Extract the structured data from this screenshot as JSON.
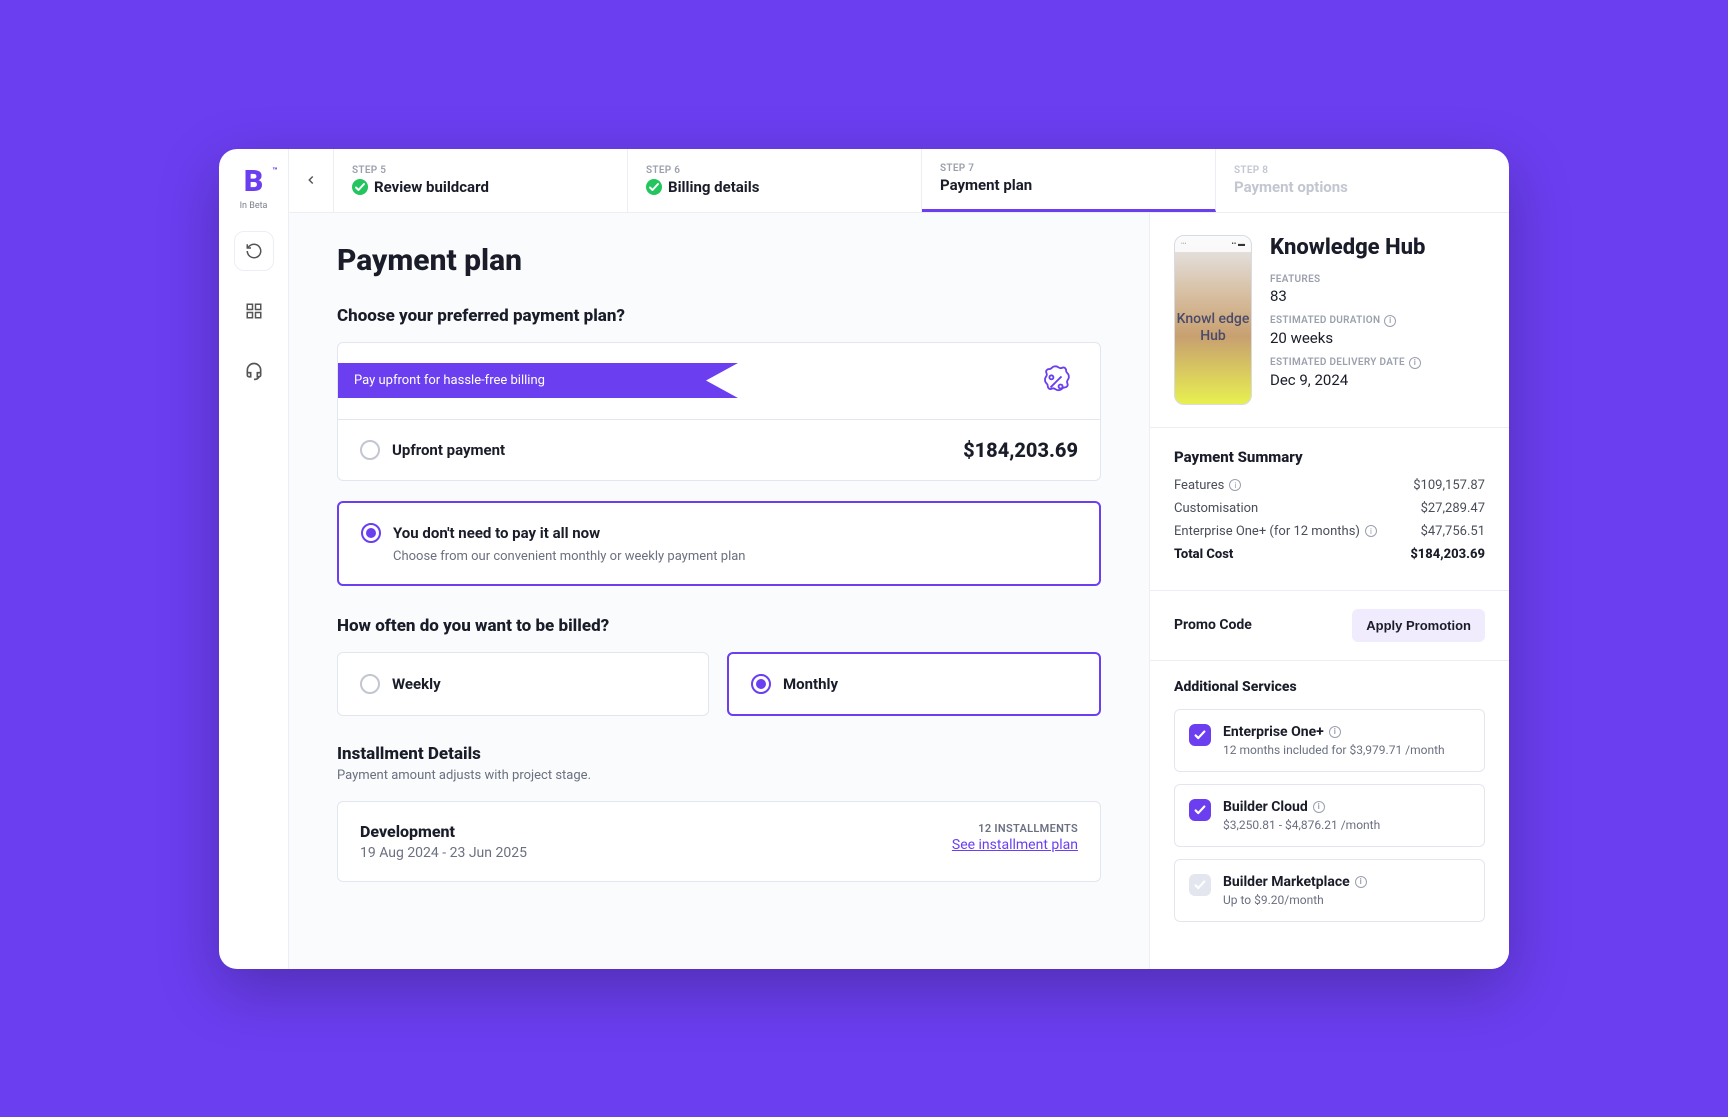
{
  "brand": {
    "letter": "B",
    "tm": "™",
    "beta": "In Beta"
  },
  "stepper": {
    "back_aria": "Back",
    "steps": [
      {
        "label": "STEP 5",
        "title": "Review buildcard",
        "state": "done"
      },
      {
        "label": "STEP 6",
        "title": "Billing details",
        "state": "done"
      },
      {
        "label": "STEP 7",
        "title": "Payment plan",
        "state": "active"
      },
      {
        "label": "STEP 8",
        "title": "Payment options",
        "state": "disabled"
      }
    ]
  },
  "page": {
    "title": "Payment plan",
    "choose_q": "Choose your preferred payment plan?",
    "ribbon": "Pay upfront for hassle-free billing",
    "upfront_label": "Upfront payment",
    "upfront_price": "$184,203.69",
    "installment_title": "You don't need to pay it all now",
    "installment_sub": "Choose from our convenient monthly or weekly payment plan",
    "freq_q": "How often do you want to be billed?",
    "weekly": "Weekly",
    "monthly": "Monthly",
    "details_title": "Installment Details",
    "details_sub": "Payment amount adjusts with project stage.",
    "dev_title": "Development",
    "dev_range": "19 Aug 2024 - 23 Jun 2025",
    "dev_inst": "12 INSTALLMENTS",
    "dev_link": "See installment plan"
  },
  "summary": {
    "phone_app": "Knowl\nedge\nHub",
    "title": "Knowledge Hub",
    "features_label": "FEATURES",
    "features_value": "83",
    "duration_label": "ESTIMATED DURATION",
    "duration_value": "20 weeks",
    "delivery_label": "ESTIMATED DELIVERY DATE",
    "delivery_value": "Dec 9, 2024",
    "pay_title": "Payment Summary",
    "rows": [
      {
        "label": "Features",
        "info": true,
        "value": "$109,157.87"
      },
      {
        "label": "Customisation",
        "info": false,
        "value": "$27,289.47"
      },
      {
        "label": "Enterprise One+ (for 12 months)",
        "info": true,
        "value": "$47,756.51"
      }
    ],
    "total_label": "Total Cost",
    "total_value": "$184,203.69",
    "promo_label": "Promo Code",
    "promo_btn": "Apply Promotion",
    "services_title": "Additional Services",
    "services": [
      {
        "title": "Enterprise One+",
        "info": true,
        "sub": "12 months included for $3,979.71 /month",
        "checked": true
      },
      {
        "title": "Builder Cloud",
        "info": true,
        "sub": "$3,250.81 - $4,876.21 /month",
        "checked": true
      },
      {
        "title": "Builder Marketplace",
        "info": true,
        "sub": "Up to $9.20/month",
        "checked": false
      }
    ]
  }
}
